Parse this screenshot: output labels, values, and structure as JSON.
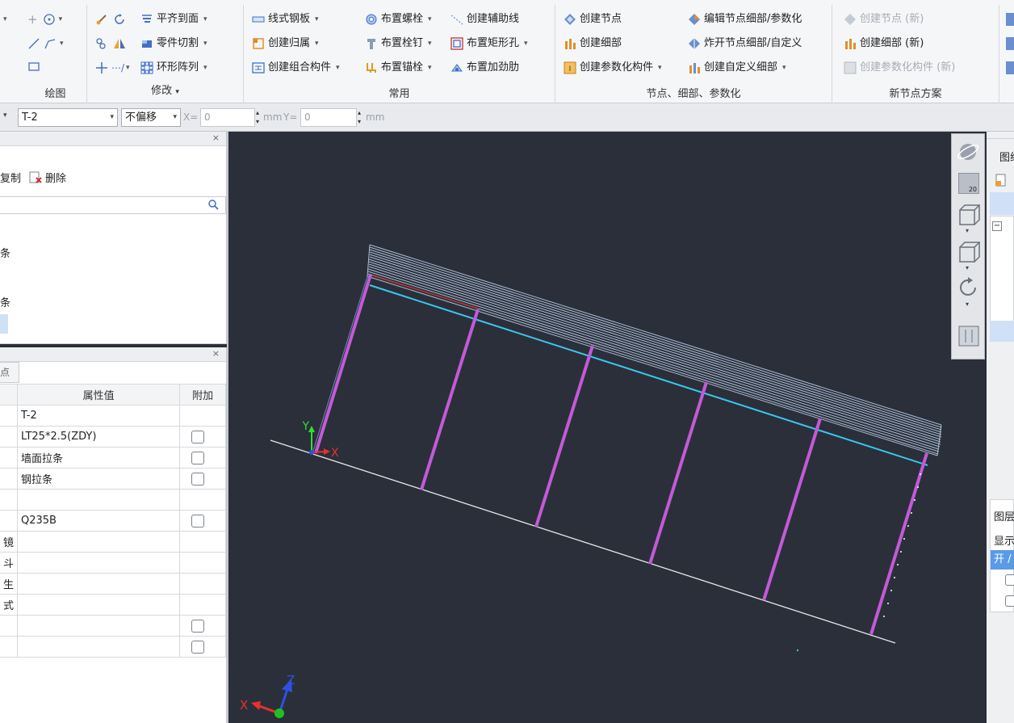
{
  "ribbon": {
    "draw": {
      "group_label": "绘图"
    },
    "modify": {
      "group_label": "修改",
      "align_label": "平齐到面",
      "cut_label": "零件切割",
      "array_label": "环形阵列"
    },
    "common": {
      "group_label": "常用",
      "linear_plate_label": "线式钢板",
      "create_belong_label": "创建归属",
      "create_combo_label": "创建组合构件",
      "place_bolt_label": "布置螺栓",
      "place_stud_label": "布置栓钉",
      "place_anchor_label": "布置锚栓",
      "create_aux_line_label": "创建辅助线",
      "place_rect_hole_label": "布置矩形孔",
      "place_stiffener_label": "布置加劲肋"
    },
    "nodes": {
      "group_label": "节点、细部、参数化",
      "create_node_label": "创建节点",
      "create_detail_label": "创建细部",
      "create_param_label": "创建参数化构件",
      "edit_node_label": "编辑节点细部/参数化",
      "explode_label": "炸开节点细部/自定义",
      "create_custom_label": "创建自定义细部"
    },
    "new_scheme": {
      "group_label": "新节点方案",
      "create_node_new_label": "创建节点 (新)",
      "create_detail_new_label": "创建细部 (新)",
      "create_param_new_label": "创建参数化构件 (新)"
    }
  },
  "cmdbar": {
    "part_select": "T-2",
    "offset_select": "不偏移",
    "x_label": "X=",
    "x_value": "0",
    "unit1": "mm",
    "y_label": "Y=",
    "y_value": "0",
    "unit2": "mm"
  },
  "panel1": {
    "copy_label": "复制",
    "delete_label": "删除",
    "tree_items": [
      "条",
      "条"
    ]
  },
  "panel2": {
    "tab_label": "点",
    "col_value": "属性值",
    "col_extra": "附加",
    "rows": [
      {
        "key": "",
        "value": "T-2",
        "check": false
      },
      {
        "key": "",
        "value": "LT25*2.5(ZDY)",
        "check": true
      },
      {
        "key": "",
        "value": "墙面拉条",
        "check": true
      },
      {
        "key": "",
        "value": "钢拉条",
        "check": true
      },
      {
        "key": "",
        "value": "",
        "check": false
      },
      {
        "key": "",
        "value": "Q235B",
        "check": true
      },
      {
        "key": "镜",
        "value": "",
        "check": false
      },
      {
        "key": "斗",
        "value": "",
        "check": false
      },
      {
        "key": "生",
        "value": "",
        "check": false
      },
      {
        "key": "式",
        "value": "",
        "check": false
      },
      {
        "key": "",
        "value": "",
        "check": true
      },
      {
        "key": "",
        "value": "",
        "check": true
      }
    ]
  },
  "viewport": {
    "ucs_x": "X",
    "ucs_y": "Y",
    "world_x": "X",
    "world_z": "Z"
  },
  "right_panel": {
    "header1": "图纸",
    "header2": "图层",
    "label_show": "显示",
    "label_open": "开 /"
  }
}
